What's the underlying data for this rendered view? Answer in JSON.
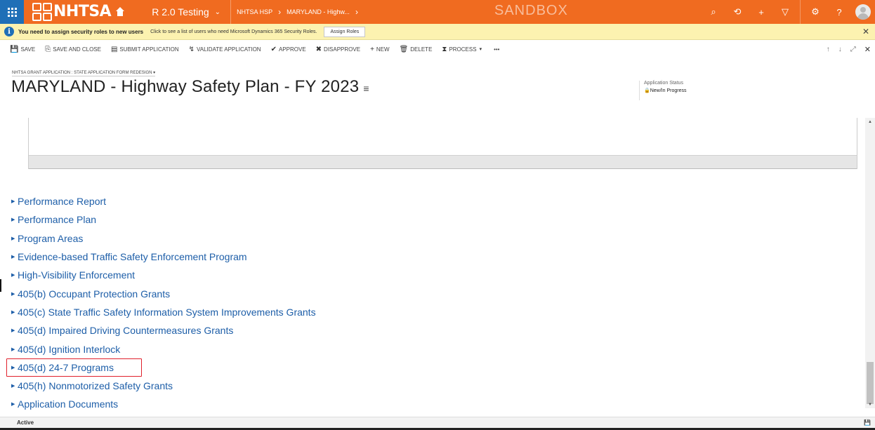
{
  "topnav": {
    "logo_text": "NHTSA",
    "environment": "R 2.0 Testing",
    "breadcrumbs": [
      "NHTSA HSP",
      "MARYLAND - Highw..."
    ],
    "sandbox": "SANDBOX",
    "accent_color": "#f06b20",
    "waffle_color": "#1f6fb7",
    "icons": [
      "search-icon",
      "history-icon",
      "plus-icon",
      "filter-icon",
      "gear-icon",
      "help-icon",
      "user-avatar-icon"
    ]
  },
  "notification": {
    "bold": "You need to assign security roles to new users",
    "message": "Click to see a list of users who need Microsoft Dynamics 365 Security Roles.",
    "button": "Assign Roles"
  },
  "commands": [
    {
      "label": "SAVE",
      "icon": "💾"
    },
    {
      "label": "SAVE AND CLOSE",
      "icon": "⎘"
    },
    {
      "label": "SUBMIT APPLICATION",
      "icon": "▤"
    },
    {
      "label": "VALIDATE APPLICATION",
      "icon": "↯"
    },
    {
      "label": "APPROVE",
      "icon": "✔"
    },
    {
      "label": "DISAPPROVE",
      "icon": "✖"
    },
    {
      "label": "NEW",
      "icon": "+"
    },
    {
      "label": "DELETE",
      "icon": "🗑"
    },
    {
      "label": "PROCESS",
      "icon": "⧗"
    },
    {
      "label": "•••",
      "icon": ""
    }
  ],
  "header": {
    "entity_form": "NHTSA GRANT APPLICATION : STATE APPLICATION FORM REDESIGN",
    "title": "MARYLAND - Highway Safety Plan - FY 2023",
    "status_label": "Application Status",
    "status_value": "New/In Progress"
  },
  "sections": [
    "Performance Report",
    "Performance Plan",
    "Program Areas",
    "Evidence-based Traffic Safety Enforcement Program",
    "High-Visibility Enforcement",
    "405(b) Occupant Protection Grants",
    "405(c) State Traffic Safety Information System Improvements Grants",
    "405(d) Impaired Driving Countermeasures Grants",
    "405(d) Ignition Interlock",
    "405(d) 24-7 Programs",
    "405(h) Nonmotorized Safety Grants",
    "Application Documents"
  ],
  "highlighted_section": "405(d) 24-7 Programs",
  "footer": {
    "status": "Active"
  }
}
